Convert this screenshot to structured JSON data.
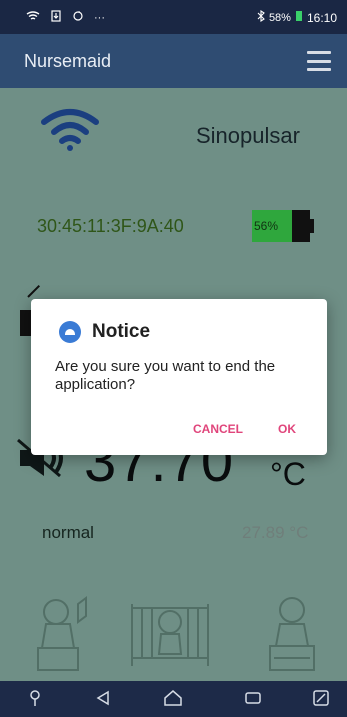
{
  "status_bar": {
    "left_icons": [
      "wifi-icon",
      "download-icon",
      "sync-icon",
      "more-icon"
    ],
    "bluetooth_icon": "bluetooth-icon",
    "battery_percent": "58%",
    "time": "16:10"
  },
  "app_bar": {
    "title": "Nursemaid",
    "menu_icon": "menu-icon"
  },
  "main": {
    "device_name": "Sinopulsar",
    "mac_address": "30:45:11:3F:9A:40",
    "battery_label": "56%",
    "temperature": "37.70",
    "temp_unit": "°C",
    "status_text": "normal",
    "secondary_temp": "27.89 °C"
  },
  "dialog": {
    "title": "Notice",
    "message": "Are you sure you want to end the application?",
    "cancel_label": "CANCEL",
    "ok_label": "OK"
  },
  "nav_bar": {
    "items": [
      "location-icon",
      "back-icon",
      "home-icon",
      "recents-icon",
      "rotate-icon"
    ]
  },
  "colors": {
    "primary": "#2f4c72",
    "accent": "#e0457b",
    "content_bg": "#6f8f86"
  }
}
